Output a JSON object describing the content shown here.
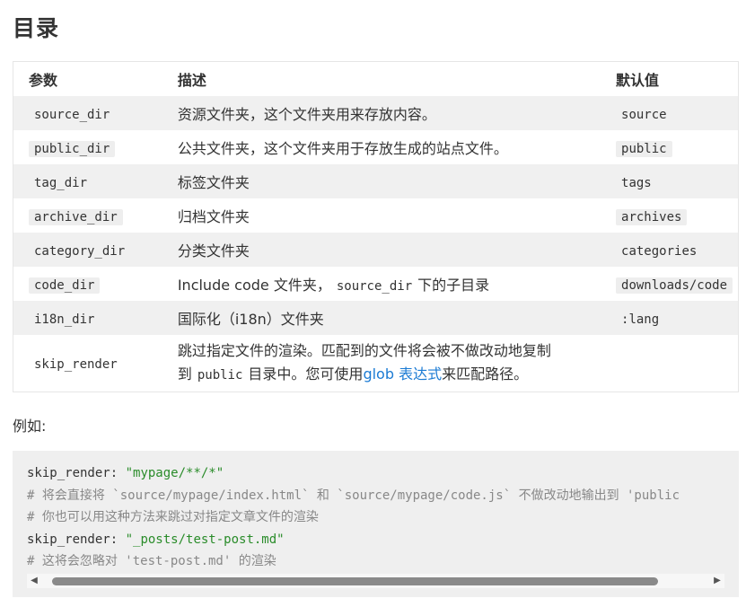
{
  "page": {
    "heading": "目录",
    "example_label": "例如:"
  },
  "table": {
    "headers": {
      "param": "参数",
      "desc": "描述",
      "default": "默认值"
    },
    "rows": [
      {
        "param": "source_dir",
        "desc": "资源文件夹，这个文件夹用来存放内容。",
        "default": "source"
      },
      {
        "param": "public_dir",
        "desc": "公共文件夹，这个文件夹用于存放生成的站点文件。",
        "default": "public"
      },
      {
        "param": "tag_dir",
        "desc": "标签文件夹",
        "default": "tags"
      },
      {
        "param": "archive_dir",
        "desc": "归档文件夹",
        "default": "archives"
      },
      {
        "param": "category_dir",
        "desc": "分类文件夹",
        "default": "categories"
      },
      {
        "param": "code_dir",
        "desc_parts": [
          "Include code 文件夹，",
          "source_dir",
          "下的子目录"
        ],
        "default": "downloads/code"
      },
      {
        "param": "i18n_dir",
        "desc": "国际化（i18n）文件夹",
        "default": ":lang"
      },
      {
        "param": "skip_render",
        "desc_line1": "跳过指定文件的渲染。匹配到的文件将会被不做改动地复制",
        "desc_line2_prefix": "到",
        "desc_line2_code": "public",
        "desc_line2_mid": "目录中。您可使用",
        "desc_link": "glob 表达式",
        "desc_line2_suffix": "来匹配路径。",
        "default": ""
      }
    ]
  },
  "code_example": {
    "lines": [
      {
        "key": "skip_render:",
        "value": "\"mypage/**/*\""
      },
      {
        "comment": "# 将会直接将 `source/mypage/index.html` 和 `source/mypage/code.js` 不做改动地输出到 'public"
      },
      {
        "comment": "# 你也可以用这种方法来跳过对指定文章文件的渲染"
      },
      {
        "key": "skip_render:",
        "value": "\"_posts/test-post.md\""
      },
      {
        "comment": "# 这将会忽略对 'test-post.md' 的渲染"
      }
    ],
    "scroll_left_icon": "◀",
    "scroll_right_icon": "▶"
  }
}
